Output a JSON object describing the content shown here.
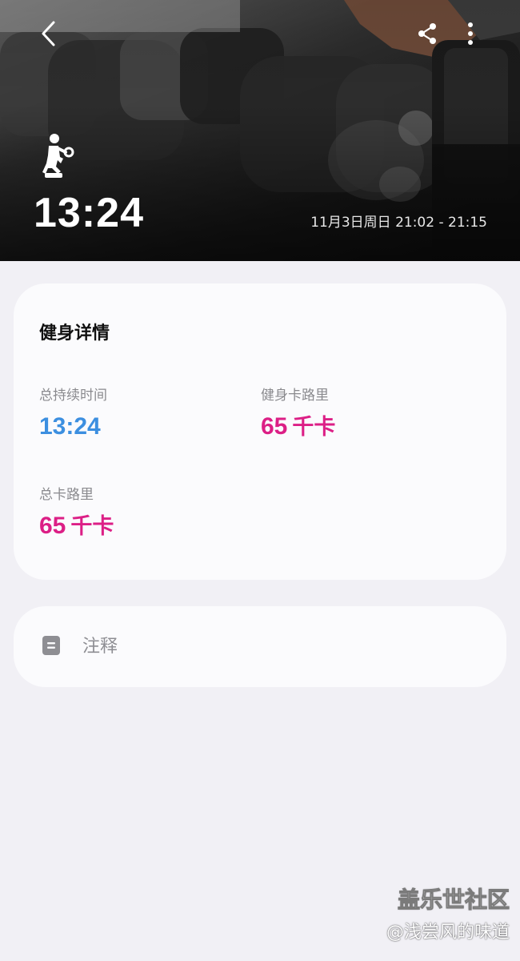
{
  "header": {
    "duration": "13:24",
    "time_range": "11月3日周日 21:02 - 21:15",
    "icons": {
      "back": "chevron-left-icon",
      "share": "share-icon",
      "more": "more-vertical-icon",
      "workout": "weight-training-icon"
    }
  },
  "details": {
    "title": "健身详情",
    "stats": {
      "duration": {
        "label": "总持续时间",
        "value": "13:24"
      },
      "workout_calories": {
        "label": "健身卡路里",
        "value": "65",
        "unit": "千卡"
      },
      "total_calories": {
        "label": "总卡路里",
        "value": "65",
        "unit": "千卡"
      }
    }
  },
  "notes": {
    "label": "注释",
    "icon": "note-icon"
  },
  "watermark": {
    "title": "盖乐世社区",
    "author": "@浅尝风的味道"
  },
  "colors": {
    "duration_blue": "#3c8fe0",
    "calorie_magenta": "#dc1f86",
    "page_bg": "#f1f0f5",
    "card_bg": "#fbfbfd"
  }
}
